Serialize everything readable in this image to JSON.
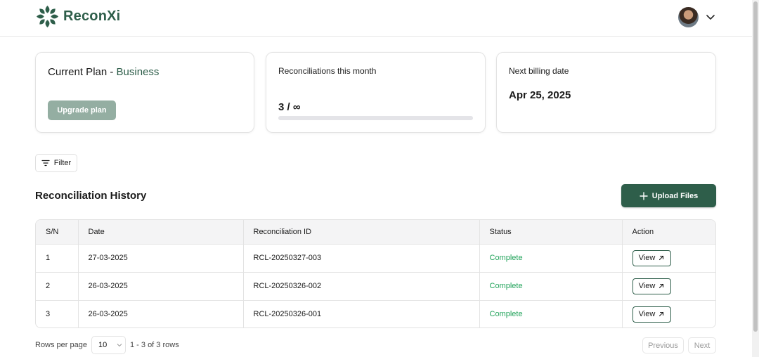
{
  "app": {
    "name": "ReconXi"
  },
  "header": {
    "user_menu_icon": "chevron-down-icon"
  },
  "plan_card": {
    "title_prefix": "Current Plan - ",
    "plan_name": "Business",
    "upgrade_label": "Upgrade plan"
  },
  "usage_card": {
    "label": "Reconciliations this month",
    "count_text": "3 / ∞",
    "progress_fraction": 0
  },
  "billing_card": {
    "label": "Next billing date",
    "date": "Apr 25, 2025"
  },
  "filter": {
    "label": "Filter",
    "icon": "filter-lines-icon"
  },
  "history": {
    "title": "Reconciliation History",
    "upload_label": "Upload Files",
    "columns": [
      "S/N",
      "Date",
      "Reconciliation ID",
      "Status",
      "Action"
    ],
    "rows": [
      {
        "sn": "1",
        "date": "27-03-2025",
        "id": "RCL-20250327-003",
        "status": "Complete",
        "action": "View"
      },
      {
        "sn": "2",
        "date": "26-03-2025",
        "id": "RCL-20250326-002",
        "status": "Complete",
        "action": "View"
      },
      {
        "sn": "3",
        "date": "26-03-2025",
        "id": "RCL-20250326-001",
        "status": "Complete",
        "action": "View"
      }
    ]
  },
  "pagination": {
    "rows_per_page_label": "Rows per page",
    "rows_per_page_value": "10",
    "range_text": "1 - 3 of 3 rows",
    "previous_label": "Previous",
    "next_label": "Next"
  },
  "colors": {
    "brand": "#2e5e4a",
    "status_complete": "#21a35a",
    "upgrade_disabled": "#94aea2"
  }
}
